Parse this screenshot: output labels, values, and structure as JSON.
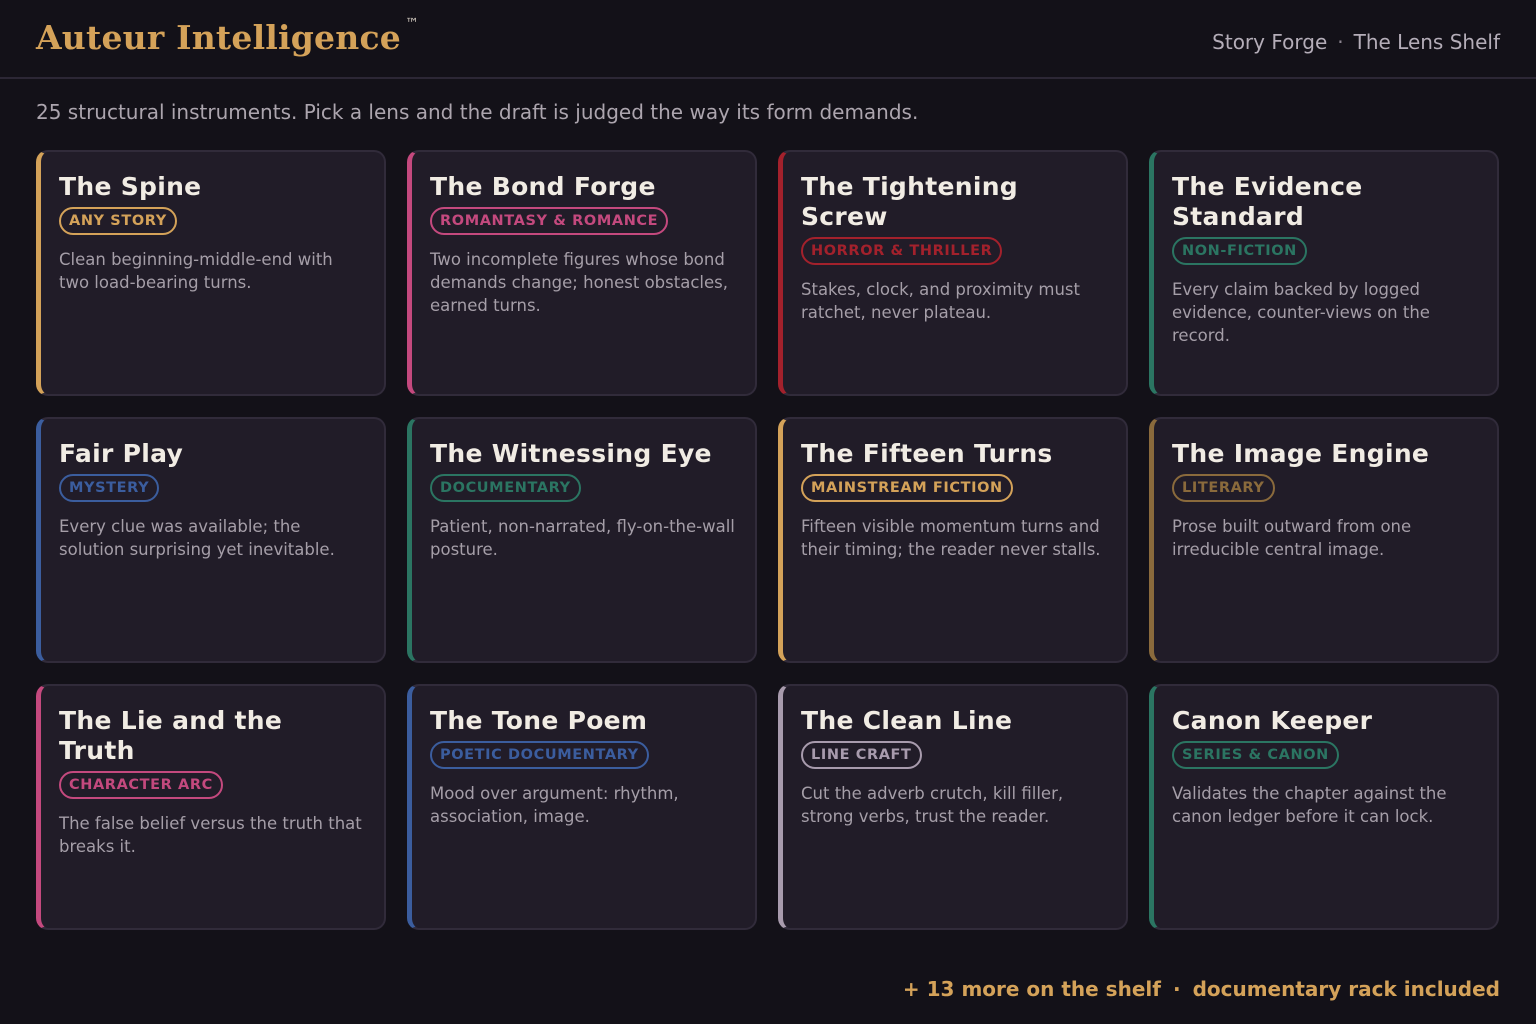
{
  "header": {
    "brand": "Auteur Intelligence",
    "trademark": "™",
    "nav": [
      {
        "label": "Story Forge"
      },
      {
        "label": "The Lens Shelf"
      }
    ],
    "nav_separator": "·"
  },
  "intro": "25 structural instruments. Pick a lens and the draft is judged the way its form demands.",
  "lenses": [
    {
      "title": "The Spine",
      "tag": "ANY STORY",
      "desc": "Clean beginning-middle-end with two load-bearing turns.",
      "accent": "#d4a259"
    },
    {
      "title": "The Bond Forge",
      "tag": "ROMANTASY & ROMANCE",
      "desc": "Two incomplete figures whose bond demands change; honest obstacles, earned turns.",
      "accent": "#c4497e"
    },
    {
      "title": "The Tightening Screw",
      "tag": "HORROR & THRILLER",
      "desc": "Stakes, clock, and proximity must ratchet, never plateau.",
      "accent": "#a3212c"
    },
    {
      "title": "The Evidence Standard",
      "tag": "NON-FICTION",
      "desc": "Every claim backed by logged evidence, counter-views on the record.",
      "accent": "#2b7562"
    },
    {
      "title": "Fair Play",
      "tag": "MYSTERY",
      "desc": "Every clue was available; the solution surprising yet inevitable.",
      "accent": "#3b5d9e"
    },
    {
      "title": "The Witnessing Eye",
      "tag": "DOCUMENTARY",
      "desc": "Patient, non-narrated, fly-on-the-wall posture.",
      "accent": "#2b7562"
    },
    {
      "title": "The Fifteen Turns",
      "tag": "MAINSTREAM FICTION",
      "desc": "Fifteen visible momentum turns and their timing; the reader never stalls.",
      "accent": "#d4a259"
    },
    {
      "title": "The Image Engine",
      "tag": "LITERARY",
      "desc": "Prose built outward from one irreducible central image.",
      "accent": "#8a6a3c"
    },
    {
      "title": "The Lie and the Truth",
      "tag": "CHARACTER ARC",
      "desc": "The false belief versus the truth that breaks it.",
      "accent": "#c4497e"
    },
    {
      "title": "The Tone Poem",
      "tag": "POETIC DOCUMENTARY",
      "desc": "Mood over argument: rhythm, association, image.",
      "accent": "#3b5d9e"
    },
    {
      "title": "The Clean Line",
      "tag": "LINE CRAFT",
      "desc": "Cut the adverb crutch, kill filler, strong verbs, trust the reader.",
      "accent": "#a89bad"
    },
    {
      "title": "Canon Keeper",
      "tag": "SERIES & CANON",
      "desc": "Validates the chapter against the canon ledger before it can lock.",
      "accent": "#2b7562"
    }
  ],
  "footer": {
    "more": "+ 13 more on the shelf",
    "separator": "·",
    "note": "documentary rack included"
  }
}
